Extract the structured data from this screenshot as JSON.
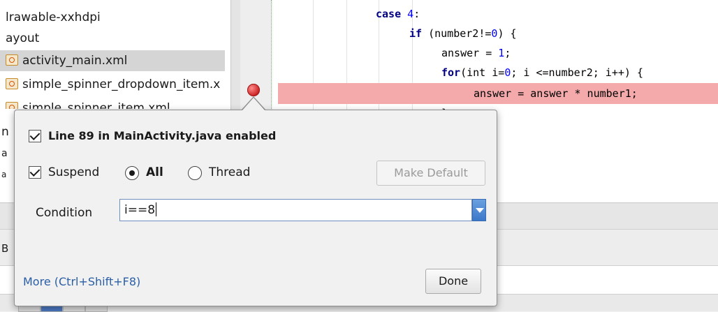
{
  "tree": {
    "items": [
      {
        "label": "lrawable-xxhdpi"
      },
      {
        "label": "ayout"
      },
      {
        "label": "activity_main.xml"
      },
      {
        "label": "simple_spinner_dropdown_item.x"
      },
      {
        "label": "simple_spinner_item.xml"
      }
    ],
    "partial_letters": [
      "n",
      "a",
      "a",
      "B"
    ]
  },
  "editor": {
    "lines": [
      {
        "text": "case ",
        "num": "4",
        "tail": ":"
      },
      {
        "kw": "if",
        "rest": " (number2!=",
        "num": "0",
        "tail": ") {"
      },
      {
        "rest": "answer = ",
        "num": "1",
        "tail": ";"
      },
      {
        "kw": "for",
        "rest": "(int i=",
        "num": "0",
        "tail": "; i <=number2; i++) {"
      },
      {
        "rest": "answer = answer * number1;"
      },
      {
        "rest": "}"
      }
    ]
  },
  "popup": {
    "enabled_label": "Line 89 in MainActivity.java enabled",
    "suspend_label": "Suspend",
    "radio_all": "All",
    "radio_thread": "Thread",
    "make_default": "Make Default",
    "condition_label": "Condition",
    "condition_value": "i==8",
    "more_link": "More (Ctrl+Shift+F8)",
    "done": "Done"
  }
}
